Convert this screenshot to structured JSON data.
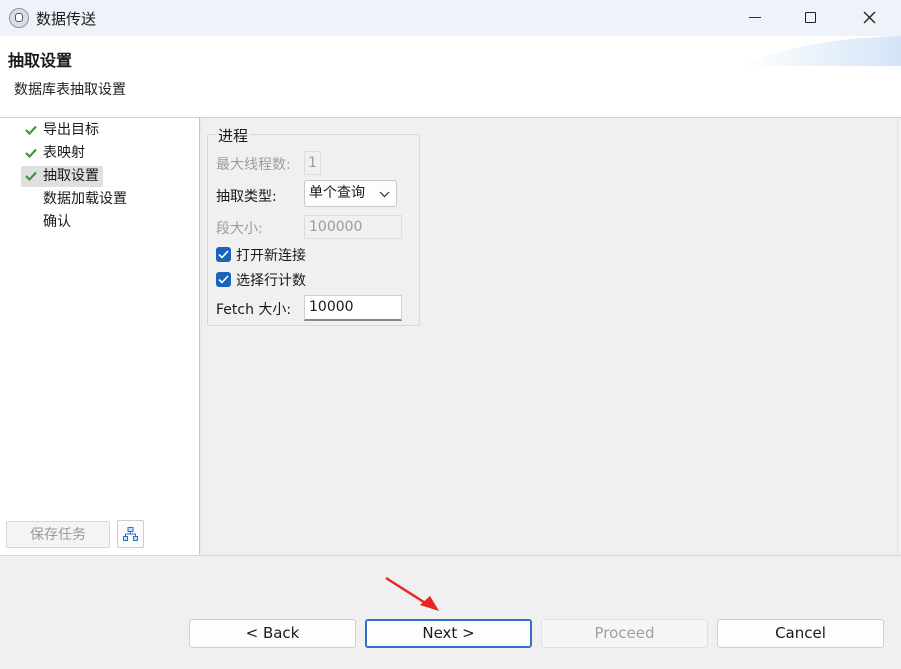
{
  "window": {
    "title": "数据传送",
    "app_icon": "app-icon",
    "controls": [
      "minimize-icon",
      "maximize-icon",
      "close-icon"
    ]
  },
  "header": {
    "title": "抽取设置",
    "subtitle": "数据库表抽取设置"
  },
  "steps": [
    {
      "label": "导出目标",
      "completed": true,
      "selected": false
    },
    {
      "label": "表映射",
      "completed": true,
      "selected": false
    },
    {
      "label": "抽取设置",
      "completed": true,
      "selected": true
    },
    {
      "label": "数据加载设置",
      "completed": false,
      "selected": false
    },
    {
      "label": "确认",
      "completed": false,
      "selected": false
    }
  ],
  "left_footer": {
    "save_task": "保存任务",
    "tree_icon": "tree-icon"
  },
  "process_group": {
    "title": "进程",
    "max_threads_label": "最大线程数:",
    "max_threads_value": "1",
    "extract_type_label": "抽取类型:",
    "extract_type_value": "单个查询",
    "segment_size_label": "段大小:",
    "segment_size_value": "100000",
    "open_new_connection_label": "打开新连接",
    "open_new_connection_checked": true,
    "select_row_count_label": "选择行计数",
    "select_row_count_checked": true,
    "fetch_size_label": "Fetch 大小:",
    "fetch_size_value": "10000"
  },
  "buttons": {
    "back": "< Back",
    "next": "Next >",
    "proceed": "Proceed",
    "cancel": "Cancel"
  },
  "colors": {
    "accent": "#1b63b8",
    "check_green": "#3a9a3a",
    "annotation_arrow": "#e8261f"
  }
}
